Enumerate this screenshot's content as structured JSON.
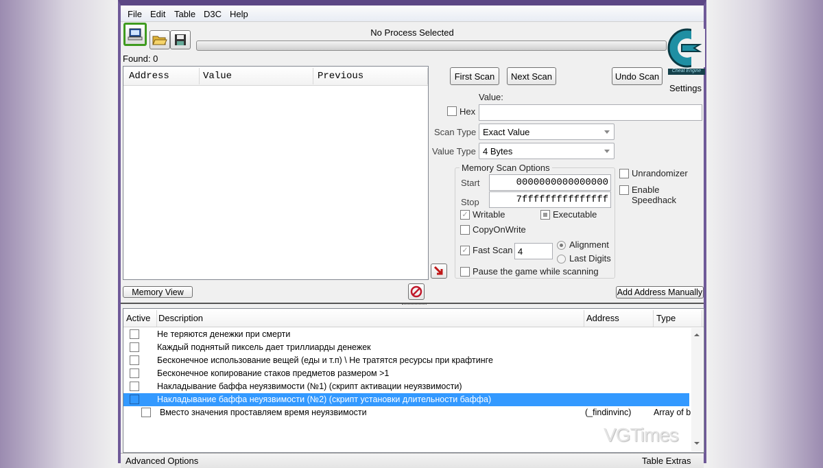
{
  "menu": [
    "File",
    "Edit",
    "Table",
    "D3C",
    "Help"
  ],
  "process_label": "No Process Selected",
  "found_label": "Found: 0",
  "results_columns": [
    "Address",
    "Value",
    "Previous"
  ],
  "buttons": {
    "first_scan": "First Scan",
    "next_scan": "Next Scan",
    "undo_scan": "Undo Scan",
    "settings": "Settings",
    "memory_view": "Memory View",
    "add_address": "Add Address Manually"
  },
  "logo_text": "Cheat Engine",
  "value_label": "Value:",
  "hex_label": "Hex",
  "value_input": "",
  "scan_type": {
    "label": "Scan Type",
    "value": "Exact Value"
  },
  "value_type": {
    "label": "Value Type",
    "value": "4 Bytes"
  },
  "memory_options": {
    "title": "Memory Scan Options",
    "start_label": "Start",
    "start_value": "0000000000000000",
    "stop_label": "Stop",
    "stop_value": "7fffffffffffffff",
    "writable": "Writable",
    "executable": "Executable",
    "copy_on_write": "CopyOnWrite",
    "fast_scan": "Fast Scan",
    "fast_scan_value": "4",
    "alignment": "Alignment",
    "last_digits": "Last Digits",
    "pause": "Pause the game while scanning"
  },
  "unrandomizer": "Unrandomizer",
  "speedhack": "Enable Speedhack",
  "table_columns": [
    "Active",
    "Description",
    "Address",
    "Type"
  ],
  "table_rows": [
    {
      "description": "Не теряются денежки при смерти",
      "address": "",
      "type": ""
    },
    {
      "description": "Каждый поднятый пиксель дает триллиарды денежек",
      "address": "",
      "type": ""
    },
    {
      "description": "Бесконечное использование вещей (еды и т.п) \\ Не тратятся ресурсы при крафтинге",
      "address": "",
      "type": ""
    },
    {
      "description": "Бесконечное копирование стаков предметов размером >1",
      "address": "",
      "type": ""
    },
    {
      "description": "Накладывание баффа неуязвимости (№1) (скрипт активации неуязвимости)",
      "address": "",
      "type": ""
    },
    {
      "description": "Накладывание баффа неуязвимости (№2) (скрипт установки длительности баффа)",
      "address": "",
      "type": ""
    },
    {
      "description": "Вместо значения проставляем время неуязвимости",
      "address": "(_findinvinc)",
      "type": "Array of b"
    }
  ],
  "footer": {
    "left": "Advanced Options",
    "right": "Table Extras"
  },
  "watermark": "VGTimes"
}
